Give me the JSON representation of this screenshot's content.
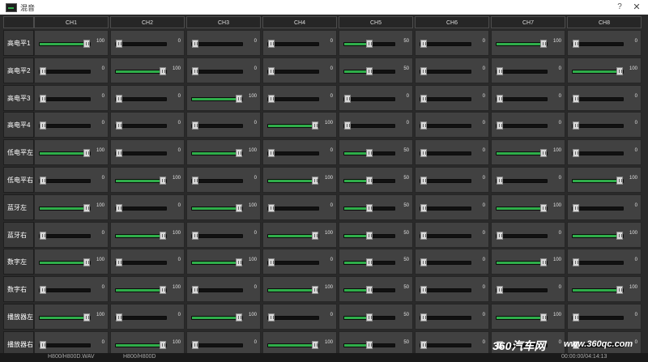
{
  "window": {
    "title": "混音",
    "help_label": "?",
    "close_label": "✕",
    "icon": "app-icon"
  },
  "channels": [
    "CH1",
    "CH2",
    "CH3",
    "CH4",
    "CH5",
    "CH6",
    "CH7",
    "CH8"
  ],
  "rows": [
    {
      "label": "高电平1",
      "values": [
        100,
        0,
        0,
        0,
        50,
        0,
        100,
        0
      ]
    },
    {
      "label": "高电平2",
      "values": [
        0,
        100,
        0,
        0,
        50,
        0,
        0,
        100
      ]
    },
    {
      "label": "高电平3",
      "values": [
        0,
        0,
        100,
        0,
        0,
        0,
        0,
        0
      ]
    },
    {
      "label": "高电平4",
      "values": [
        0,
        0,
        0,
        100,
        0,
        0,
        0,
        0
      ]
    },
    {
      "label": "低电平左",
      "values": [
        100,
        0,
        100,
        0,
        50,
        0,
        100,
        0
      ]
    },
    {
      "label": "低电平右",
      "values": [
        0,
        100,
        0,
        100,
        50,
        0,
        0,
        100
      ]
    },
    {
      "label": "蓝牙左",
      "values": [
        100,
        0,
        100,
        0,
        50,
        0,
        100,
        0
      ]
    },
    {
      "label": "蓝牙右",
      "values": [
        0,
        100,
        0,
        100,
        50,
        0,
        0,
        100
      ]
    },
    {
      "label": "数字左",
      "values": [
        100,
        0,
        100,
        0,
        50,
        0,
        100,
        0
      ]
    },
    {
      "label": "数字右",
      "values": [
        0,
        100,
        0,
        100,
        50,
        0,
        0,
        100
      ]
    },
    {
      "label": "播放器左",
      "values": [
        100,
        0,
        100,
        0,
        50,
        0,
        100,
        0
      ]
    },
    {
      "label": "播放器右",
      "values": [
        0,
        100,
        0,
        100,
        50,
        0,
        0,
        0
      ]
    }
  ],
  "colors": {
    "fill": "#2fae4a",
    "cell_bg": "#414141",
    "panel_bg": "#2a2a2a"
  },
  "bottom_strip": {
    "text1": "H800/H800D.WAV",
    "text2": "H800/H800D",
    "time": "00:00:00/04:14:13"
  },
  "watermark": {
    "brand": "360汽车网",
    "url": "www.360qc.com"
  }
}
